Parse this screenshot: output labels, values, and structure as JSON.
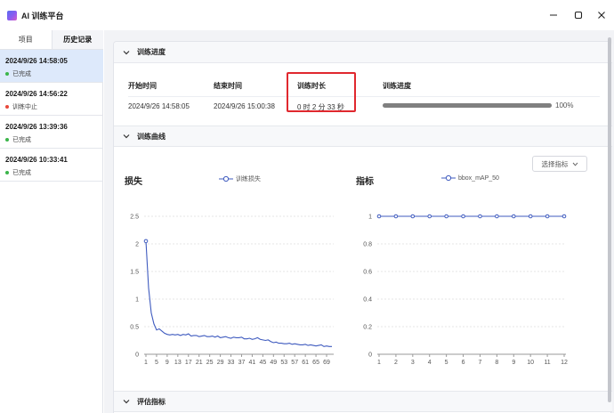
{
  "app": {
    "title": "AI 训练平台"
  },
  "sidebar": {
    "tabs": [
      "项目",
      "历史记录"
    ],
    "active_tab": "历史记录",
    "history": [
      {
        "time": "2024/9/26 14:58:05",
        "status": "已完成",
        "status_color": "#3bb54a",
        "selected": true
      },
      {
        "time": "2024/9/26 14:56:22",
        "status": "训练中止",
        "status_color": "#e8483a",
        "selected": false
      },
      {
        "time": "2024/9/26 13:39:36",
        "status": "已完成",
        "status_color": "#3bb54a",
        "selected": false
      },
      {
        "time": "2024/9/26 10:33:41",
        "status": "已完成",
        "status_color": "#3bb54a",
        "selected": false
      }
    ]
  },
  "progress_section": {
    "title": "训练进度",
    "columns": {
      "start": "开始时间",
      "end": "结束时间",
      "duration": "训练时长",
      "progress": "训练进度"
    },
    "values": {
      "start": "2024/9/26 14:58:05",
      "end": "2024/9/26 15:00:38",
      "duration": "0 时 2 分 33 秒",
      "progress_pct": "100%",
      "progress_fraction": 1.0
    }
  },
  "curve_section": {
    "title": "训练曲线",
    "metric_select": "选择指标"
  },
  "eval_section": {
    "title": "评估指标"
  },
  "colors": {
    "series": "#3f5bbf",
    "highlight": "#e0282e",
    "progress": "#808080"
  },
  "chart_data": [
    {
      "type": "line",
      "title": "损失",
      "series": [
        {
          "name": "训练损失",
          "x": [
            1,
            2,
            3,
            4,
            5,
            6,
            7,
            8,
            9,
            10,
            11,
            12,
            13,
            14,
            15,
            16,
            17,
            18,
            19,
            20,
            21,
            22,
            23,
            24,
            25,
            26,
            27,
            28,
            29,
            30,
            31,
            32,
            33,
            34,
            35,
            36,
            37,
            38,
            39,
            40,
            41,
            42,
            43,
            44,
            45,
            46,
            47,
            48,
            49,
            50,
            51,
            52,
            53,
            54,
            55,
            56,
            57,
            58,
            59,
            60,
            61,
            62,
            63,
            64,
            65,
            66,
            67,
            68,
            69,
            70,
            71
          ],
          "values": [
            2.05,
            1.2,
            0.75,
            0.55,
            0.44,
            0.46,
            0.42,
            0.38,
            0.36,
            0.35,
            0.36,
            0.35,
            0.36,
            0.34,
            0.36,
            0.35,
            0.37,
            0.33,
            0.34,
            0.34,
            0.32,
            0.33,
            0.34,
            0.32,
            0.32,
            0.33,
            0.31,
            0.33,
            0.3,
            0.31,
            0.32,
            0.3,
            0.29,
            0.31,
            0.3,
            0.3,
            0.31,
            0.28,
            0.28,
            0.29,
            0.27,
            0.28,
            0.3,
            0.27,
            0.26,
            0.25,
            0.26,
            0.23,
            0.21,
            0.22,
            0.2,
            0.2,
            0.19,
            0.19,
            0.2,
            0.18,
            0.19,
            0.18,
            0.17,
            0.17,
            0.18,
            0.16,
            0.17,
            0.16,
            0.15,
            0.16,
            0.17,
            0.14,
            0.15,
            0.14,
            0.14
          ]
        }
      ],
      "x_ticks": [
        "1",
        "5",
        "9",
        "13",
        "17",
        "21",
        "25",
        "29",
        "33",
        "37",
        "41",
        "45",
        "49",
        "53",
        "57",
        "61",
        "65",
        "69"
      ],
      "y_ticks": [
        "0",
        "0.5",
        "1",
        "1.5",
        "2",
        "2.5"
      ],
      "ylim": [
        0,
        2.5
      ]
    },
    {
      "type": "line",
      "title": "指标",
      "series": [
        {
          "name": "bbox_mAP_50",
          "x": [
            1,
            2,
            3,
            4,
            5,
            6,
            7,
            8,
            9,
            10,
            11,
            12
          ],
          "values": [
            1,
            1,
            1,
            1,
            1,
            1,
            1,
            1,
            1,
            1,
            1,
            1
          ]
        }
      ],
      "x_ticks": [
        "1",
        "2",
        "3",
        "4",
        "5",
        "6",
        "7",
        "8",
        "9",
        "10",
        "11",
        "12"
      ],
      "y_ticks": [
        "0",
        "0.2",
        "0.4",
        "0.6",
        "0.8",
        "1"
      ],
      "ylim": [
        0,
        1
      ]
    }
  ]
}
